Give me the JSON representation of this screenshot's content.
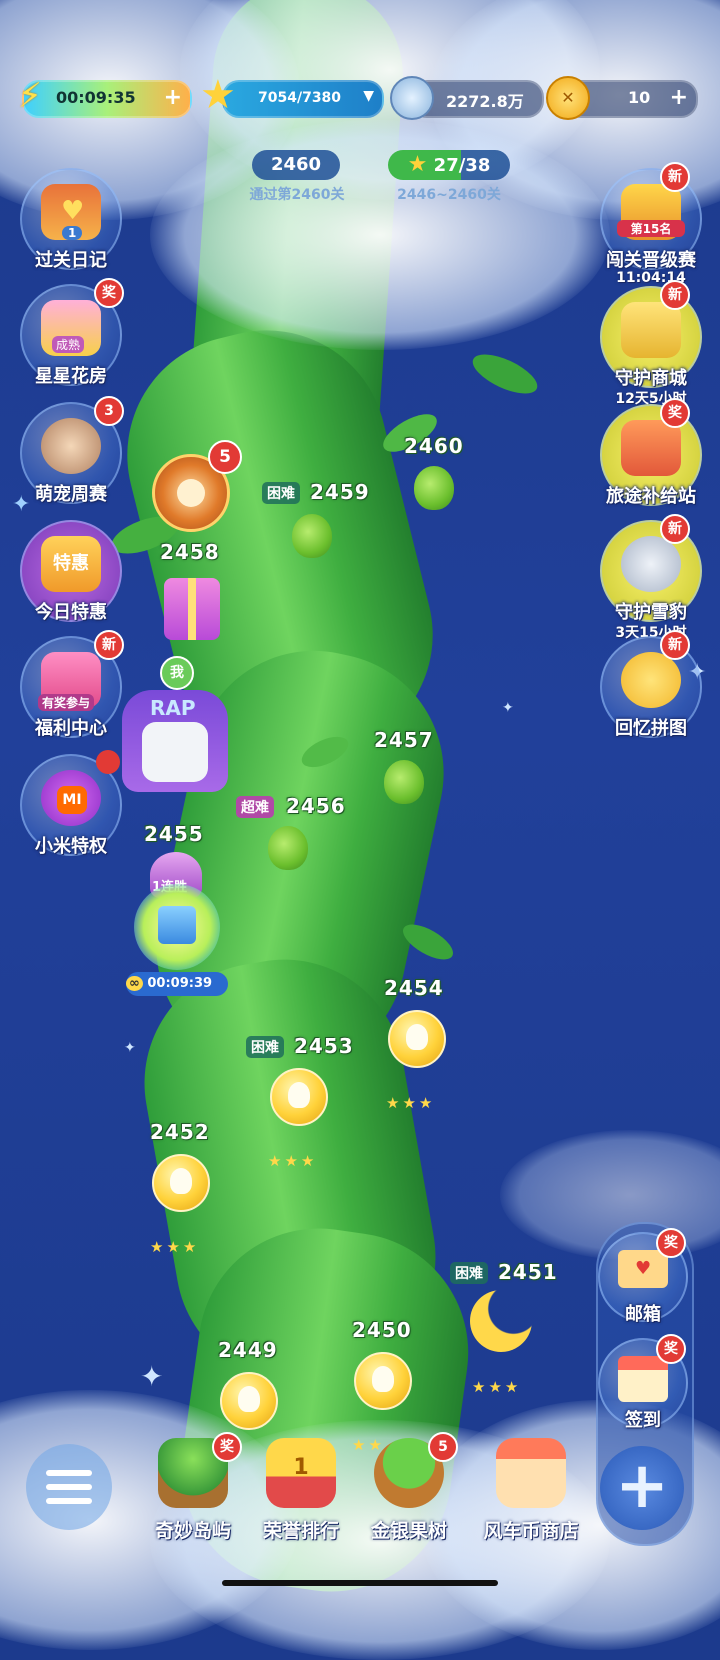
{
  "top_bar": {
    "energy_timer": "00:09:35",
    "stars": "7054/7380",
    "gems": "2272.8万",
    "coins": "10"
  },
  "progress": {
    "level_pill": "2460",
    "level_caption": "通过第2460关",
    "star_pill": "27/38",
    "star_caption": "2446~2460关"
  },
  "left_menu": [
    {
      "label": "过关日记",
      "counter": "1"
    },
    {
      "label": "星星花房",
      "badge": "奖",
      "sub": "成熟"
    },
    {
      "label": "萌宠周赛",
      "badge": "3"
    },
    {
      "label": "今日特惠",
      "icon_text": "特惠"
    },
    {
      "label": "福利中心",
      "badge": "新",
      "icon_text": "有奖参与"
    },
    {
      "label": "小米特权",
      "icon_text": "MI"
    }
  ],
  "right_menu": [
    {
      "label": "闯关晋级赛",
      "badge": "新",
      "sub": "11:04:14",
      "icon_text": "第15名"
    },
    {
      "label": "守护商城",
      "badge": "新",
      "sub": "12天5小时"
    },
    {
      "label": "旅途补给站",
      "badge": "奖"
    },
    {
      "label": "守护雪豹",
      "badge": "新",
      "sub": "3天15小时"
    },
    {
      "label": "回忆拼图",
      "badge": "新"
    }
  ],
  "levels": {
    "l2460": "2460",
    "l2459": "2459",
    "l2459_tag": "困难",
    "l2458": "2458",
    "l2457": "2457",
    "l2456": "2456",
    "l2456_tag": "超难",
    "l2455": "2455",
    "streak": "1连胜",
    "gift_timer": "00:09:39",
    "l2454": "2454",
    "l2453": "2453",
    "l2453_tag": "困难",
    "l2452": "2452",
    "l2451": "2451",
    "l2451_tag": "困难",
    "l2450": "2450",
    "l2449": "2449",
    "wheel_badge": "5",
    "me_label": "我",
    "hat_text": "RAP"
  },
  "right_bottom": {
    "mail_label": "邮箱",
    "mail_badge": "奖",
    "checkin_label": "签到",
    "checkin_badge": "奖"
  },
  "bottom_nav": [
    {
      "label": "奇妙岛屿",
      "badge": "奖"
    },
    {
      "label": "荣誉排行",
      "icon_text": "1"
    },
    {
      "label": "金银果树",
      "badge": "5"
    },
    {
      "label": "风车币商店"
    }
  ],
  "icons": {
    "energy": "lightning-icon",
    "star": "star-icon",
    "gem": "gem-icon",
    "coin": "coin-icon",
    "menu": "hamburger-icon",
    "plus": "plus-icon"
  }
}
